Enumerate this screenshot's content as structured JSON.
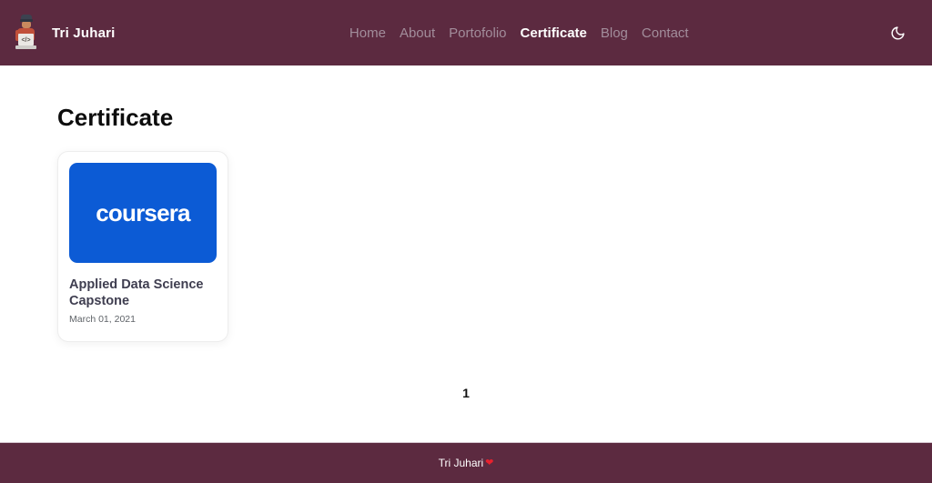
{
  "header": {
    "brand": "Tri Juhari",
    "nav": [
      {
        "label": "Home",
        "active": false
      },
      {
        "label": "About",
        "active": false
      },
      {
        "label": "Portofolio",
        "active": false
      },
      {
        "label": "Certificate",
        "active": true
      },
      {
        "label": "Blog",
        "active": false
      },
      {
        "label": "Contact",
        "active": false
      }
    ],
    "theme_toggle_icon": "moon-icon"
  },
  "main": {
    "heading": "Certificate",
    "card": {
      "logo_text": "coursera",
      "title": "Applied Data Science Capstone",
      "date": "March 01, 2021"
    },
    "pagination": {
      "current": "1"
    }
  },
  "footer": {
    "text": "Tri Juhari",
    "heart": "❤"
  },
  "colors": {
    "header_bg": "#5C2A40",
    "footer_bg": "#5C2A40",
    "coursera_blue": "#0C5BD5",
    "nav_inactive": "#A28D9B",
    "nav_active": "#FFFFFF",
    "card_title": "#3F3E50",
    "heart_red": "#E8212E"
  }
}
